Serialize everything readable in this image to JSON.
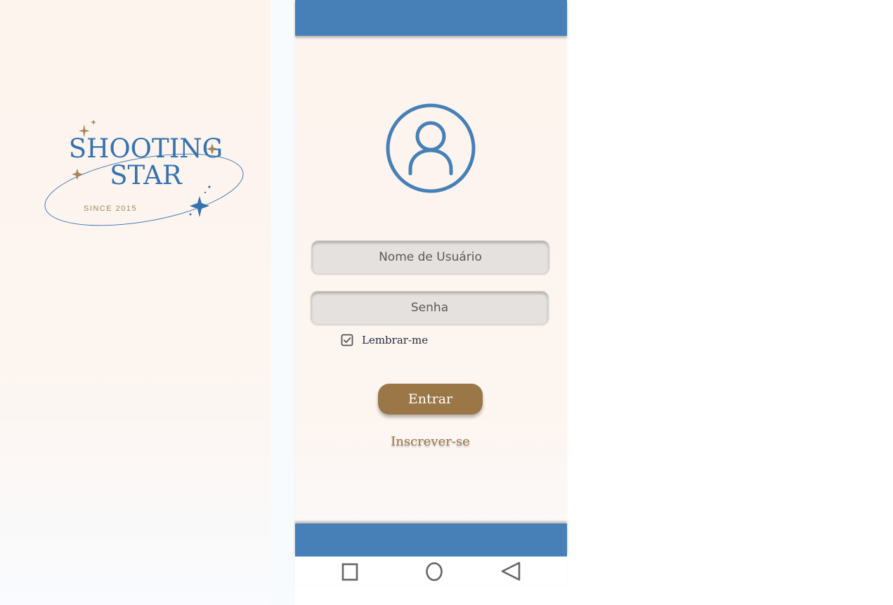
{
  "brand": {
    "line1": "SHOOTING",
    "line2": "STAR",
    "since": "SINCE 2015",
    "logo_color": "#3573b0",
    "accent_color": "#a88557"
  },
  "colors": {
    "bar_blue": "#4680b7",
    "button_brown": "#9b7748",
    "field_bg": "#e4e1de",
    "background": "#fdf4ee"
  },
  "login": {
    "avatar_icon": "user-circle-icon",
    "username_placeholder": "Nome de Usuário",
    "password_placeholder": "Senha",
    "remember_label": "Lembrar-me",
    "remember_checked": true,
    "submit_label": "Entrar",
    "signup_label": "Inscrever-se"
  },
  "nav": {
    "recent_icon": "square-icon",
    "home_icon": "circle-icon",
    "back_icon": "triangle-back-icon"
  }
}
